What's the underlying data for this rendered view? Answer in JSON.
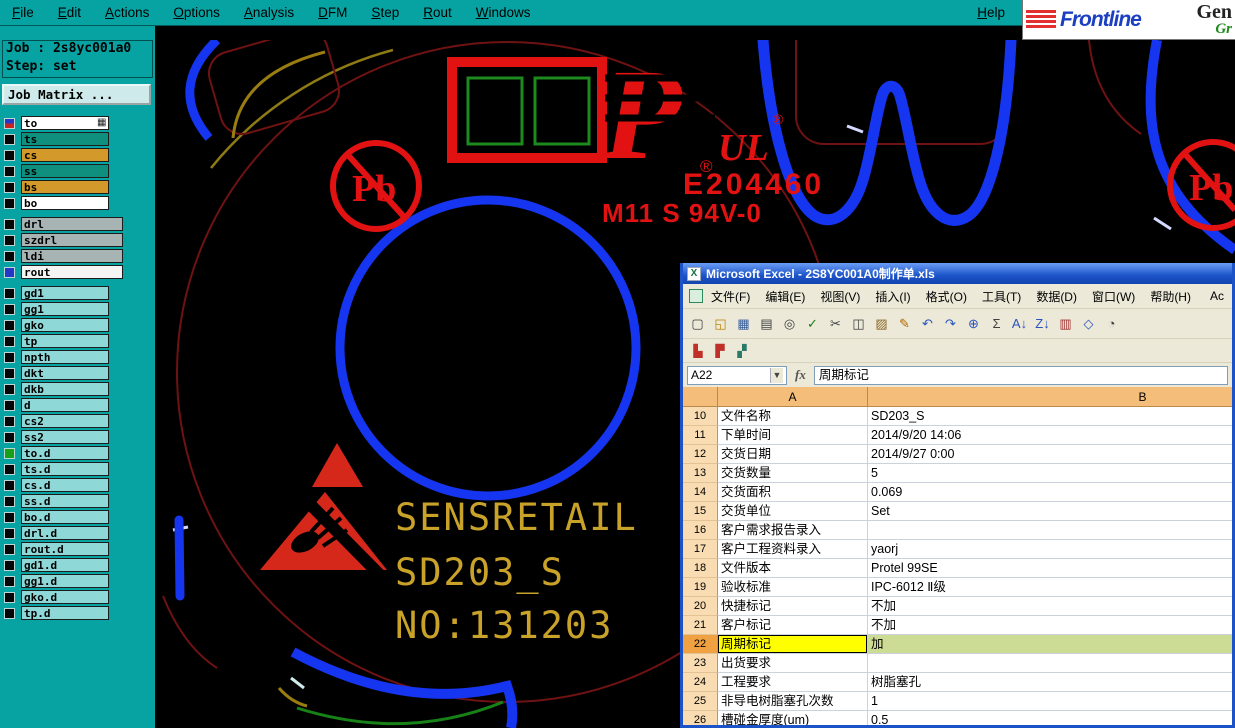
{
  "menubar": {
    "items": [
      "File",
      "Edit",
      "Actions",
      "Options",
      "Analysis",
      "DFM",
      "Step",
      "Rout",
      "Windows"
    ],
    "help": "Help"
  },
  "brand": {
    "name": "Frontline",
    "suffix_top": "Gen",
    "suffix_bottom": "Gr"
  },
  "panel": {
    "job": "Job : 2s8yc001a0",
    "step": "Step: set",
    "matrix_button": "Job Matrix ...",
    "layers": [
      {
        "name": "to",
        "field": "#ffffff",
        "cls": "ind-split",
        "icon": "▦"
      },
      {
        "name": "ts",
        "field": "#0f8f7d"
      },
      {
        "name": "cs",
        "field": "#d39a2b"
      },
      {
        "name": "ss",
        "field": "#0f8f7d"
      },
      {
        "name": "bs",
        "field": "#d39a2b"
      },
      {
        "name": "bo",
        "field": "#ffffff"
      },
      {
        "name": "drl",
        "field": "#a8b4b4",
        "cls": "gap wide"
      },
      {
        "name": "szdrl",
        "field": "#a8b4b4",
        "cls": "wide"
      },
      {
        "name": "ldi",
        "field": "#a8b4b4",
        "cls": "wide"
      },
      {
        "name": "rout",
        "field": "#f4f4f4",
        "cls": "wide ind-blue"
      },
      {
        "name": "gd1",
        "field": "#8fd8d8",
        "cls": "gap"
      },
      {
        "name": "gg1",
        "field": "#8fd8d8"
      },
      {
        "name": "gko",
        "field": "#8fd8d8"
      },
      {
        "name": "tp",
        "field": "#8fd8d8"
      },
      {
        "name": "npth",
        "field": "#8fd8d8"
      },
      {
        "name": "dkt",
        "field": "#8fd8d8"
      },
      {
        "name": "dkb",
        "field": "#8fd8d8"
      },
      {
        "name": "d",
        "field": "#8fd8d8"
      },
      {
        "name": "cs2",
        "field": "#8fd8d8"
      },
      {
        "name": "ss2",
        "field": "#8fd8d8"
      },
      {
        "name": "to.d",
        "field": "#8fd8d8",
        "cls": "ind-green"
      },
      {
        "name": "ts.d",
        "field": "#8fd8d8"
      },
      {
        "name": "cs.d",
        "field": "#8fd8d8"
      },
      {
        "name": "ss.d",
        "field": "#8fd8d8"
      },
      {
        "name": "bo.d",
        "field": "#8fd8d8"
      },
      {
        "name": "drl.d",
        "field": "#8fd8d8"
      },
      {
        "name": "rout.d",
        "field": "#8fd8d8"
      },
      {
        "name": "gd1.d",
        "field": "#8fd8d8"
      },
      {
        "name": "gg1.d",
        "field": "#8fd8d8"
      },
      {
        "name": "gko.d",
        "field": "#8fd8d8"
      },
      {
        "name": "tp.d",
        "field": "#8fd8d8"
      }
    ]
  },
  "pcb": {
    "logo_p": "P",
    "ul": "UL",
    "reg": "®",
    "file_no": "E204460",
    "type_line": "M11 S 94V-0",
    "pb": "Pb",
    "brand_text": "SENSRETAIL",
    "model_text": "SD203_S",
    "serial_text": "NO:131203"
  },
  "colors": {
    "panel_teal": "#07a3a3",
    "trace_blue": "#1535f0",
    "silk_red": "#e21212",
    "silk_gold": "#c9a22a",
    "outline_maroon": "#6e1212",
    "outline_green": "#178217",
    "excel_header_orange": "#f5bd7a",
    "highlight_yellow": "#ffff00",
    "highlight_green": "#ccdc94"
  },
  "excel": {
    "title": "Microsoft Excel - 2S8YC001A0制作单.xls",
    "app_icon": "X",
    "menus": [
      {
        "label": "文件(F)"
      },
      {
        "label": "编辑(E)"
      },
      {
        "label": "视图(V)"
      },
      {
        "label": "插入(I)"
      },
      {
        "label": "格式(O)"
      },
      {
        "label": "工具(T)"
      },
      {
        "label": "数据(D)"
      },
      {
        "label": "窗口(W)"
      },
      {
        "label": "帮助(H)"
      },
      {
        "label": "Ac",
        "cls": "push"
      }
    ],
    "toolbar1": [
      {
        "n": "new",
        "g": "▢"
      },
      {
        "n": "open",
        "g": "◱",
        "c": "#b8860b"
      },
      {
        "n": "save",
        "g": "▦",
        "c": "#335a9a"
      },
      {
        "n": "print",
        "g": "▤"
      },
      {
        "n": "print-preview",
        "g": "◎"
      },
      {
        "n": "spelling",
        "g": "✓",
        "c": "#1a7a1a"
      },
      {
        "n": "cut",
        "g": "✂"
      },
      {
        "n": "copy",
        "g": "◫"
      },
      {
        "n": "paste",
        "g": "▨",
        "c": "#8a6a2a"
      },
      {
        "n": "format-painter",
        "g": "✎",
        "c": "#b06a00"
      },
      {
        "n": "undo",
        "g": "↶",
        "c": "#2a52be"
      },
      {
        "n": "redo",
        "g": "↷",
        "c": "#2a52be"
      },
      {
        "n": "hyperlink",
        "g": "⊕",
        "c": "#2a52be"
      },
      {
        "n": "autosum",
        "g": "Σ"
      },
      {
        "n": "sort-ascending",
        "g": "A↓",
        "c": "#2a52be"
      },
      {
        "n": "sort-descending",
        "g": "Z↓",
        "c": "#2a52be"
      },
      {
        "n": "chart-wizard",
        "g": "▥",
        "c": "#a03030"
      },
      {
        "n": "drawing",
        "g": "◇",
        "c": "#2a52be"
      },
      {
        "n": "zoom",
        "g": "◔"
      }
    ],
    "toolbar2": [
      {
        "n": "pdf-convert",
        "g": "▙",
        "c": "#c03028"
      },
      {
        "n": "pdf-mail",
        "g": "▛",
        "c": "#c03028"
      },
      {
        "n": "custom-tool",
        "g": "▞",
        "c": "#2a7a6a"
      }
    ],
    "name_box": "A22",
    "dropdown": "▼",
    "fx": "fx",
    "formula_value": "周期标记",
    "col_a": "A",
    "col_b": "B",
    "rows": [
      {
        "n": "10",
        "a": "文件名称",
        "b": "SD203_S"
      },
      {
        "n": "11",
        "a": "下单时间",
        "b": "2014/9/20 14:06"
      },
      {
        "n": "12",
        "a": "交货日期",
        "b": "2014/9/27 0:00"
      },
      {
        "n": "13",
        "a": "交货数量",
        "b": "5"
      },
      {
        "n": "14",
        "a": "交货面积",
        "b": "0.069"
      },
      {
        "n": "15",
        "a": "交货单位",
        "b": "Set"
      },
      {
        "n": "16",
        "a": "客户需求报告录入",
        "b": ""
      },
      {
        "n": "17",
        "a": "客户工程资料录入",
        "b": "yaorj"
      },
      {
        "n": "18",
        "a": "文件版本",
        "b": "Protel 99SE"
      },
      {
        "n": "19",
        "a": "验收标准",
        "b": "IPC-6012 Ⅱ级"
      },
      {
        "n": "20",
        "a": "快捷标记",
        "b": "不加"
      },
      {
        "n": "21",
        "a": "客户标记",
        "b": "不加"
      },
      {
        "n": "22",
        "a": "周期标记",
        "b": "加",
        "cls": "hl"
      },
      {
        "n": "23",
        "a": "出货要求",
        "b": ""
      },
      {
        "n": "24",
        "a": "工程要求",
        "b": "树脂塞孔"
      },
      {
        "n": "25",
        "a": "非导电树脂塞孔次数",
        "b": "1"
      },
      {
        "n": "26",
        "a": "槽碰金厚度(um)",
        "b": "0.5"
      }
    ]
  }
}
